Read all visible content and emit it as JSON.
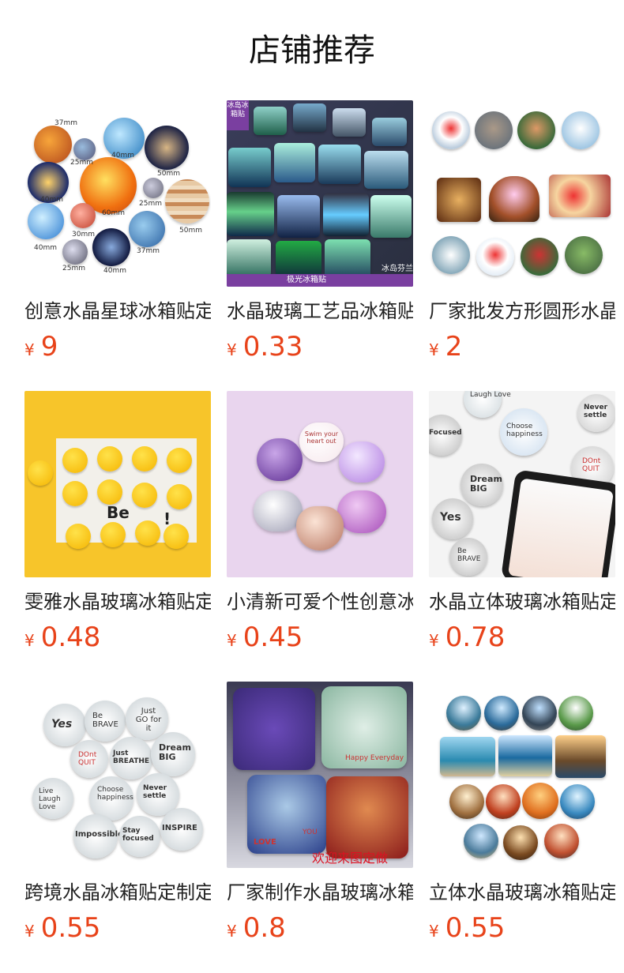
{
  "header": {
    "title": "店铺推荐"
  },
  "products": [
    {
      "title": "创意水晶星球冰箱贴定制",
      "currency": "¥",
      "price": "9",
      "image_text": [
        "37mm",
        "25mm",
        "40mm",
        "50mm",
        "40mm",
        "60mm",
        "25mm",
        "30mm",
        "50mm",
        "40mm",
        "25mm",
        "40mm",
        "37mm"
      ]
    },
    {
      "title": "水晶玻璃工艺品冰箱贴",
      "currency": "¥",
      "price": "0.33",
      "image_text": [
        "冰岛冰箱贴",
        "极光冰箱贴",
        "冰岛芬兰"
      ]
    },
    {
      "title": "厂家批发方形圆形水晶",
      "currency": "¥",
      "price": "2",
      "image_text": []
    },
    {
      "title": "雯雅水晶玻璃冰箱贴定制",
      "currency": "¥",
      "price": "0.48",
      "image_text": [
        "Be",
        "!"
      ]
    },
    {
      "title": "小清新可爱个性创意冰箱贴",
      "currency": "¥",
      "price": "0.45",
      "image_text": [
        "Swim your heart out"
      ]
    },
    {
      "title": "水晶立体玻璃冰箱贴定制",
      "currency": "¥",
      "price": "0.78",
      "image_text": [
        "Laugh Love",
        "Choose happiness",
        "Never settle",
        "Focused",
        "Dream BIG",
        "DOnt QUIT",
        "Yes",
        "Be BRAVE"
      ]
    },
    {
      "title": "跨境水晶冰箱贴定制定做",
      "currency": "¥",
      "price": "0.55",
      "image_text": [
        "Yes",
        "Be BRAVE",
        "Just GO for it",
        "DOnt QUIT",
        "Just BREATHE",
        "Dream BIG",
        "Live Laugh Love",
        "Choose happiness",
        "Never settle",
        "Impossible",
        "Stay focused",
        "INSPIRE"
      ]
    },
    {
      "title": "厂家制作水晶玻璃冰箱贴",
      "currency": "¥",
      "price": "0.8",
      "image_text": [
        "Happy Everyday",
        "LOVE",
        "YOU",
        "欢迎来图定做"
      ]
    },
    {
      "title": "立体水晶玻璃冰箱贴定制",
      "currency": "¥",
      "price": "0.55",
      "image_text": []
    }
  ]
}
